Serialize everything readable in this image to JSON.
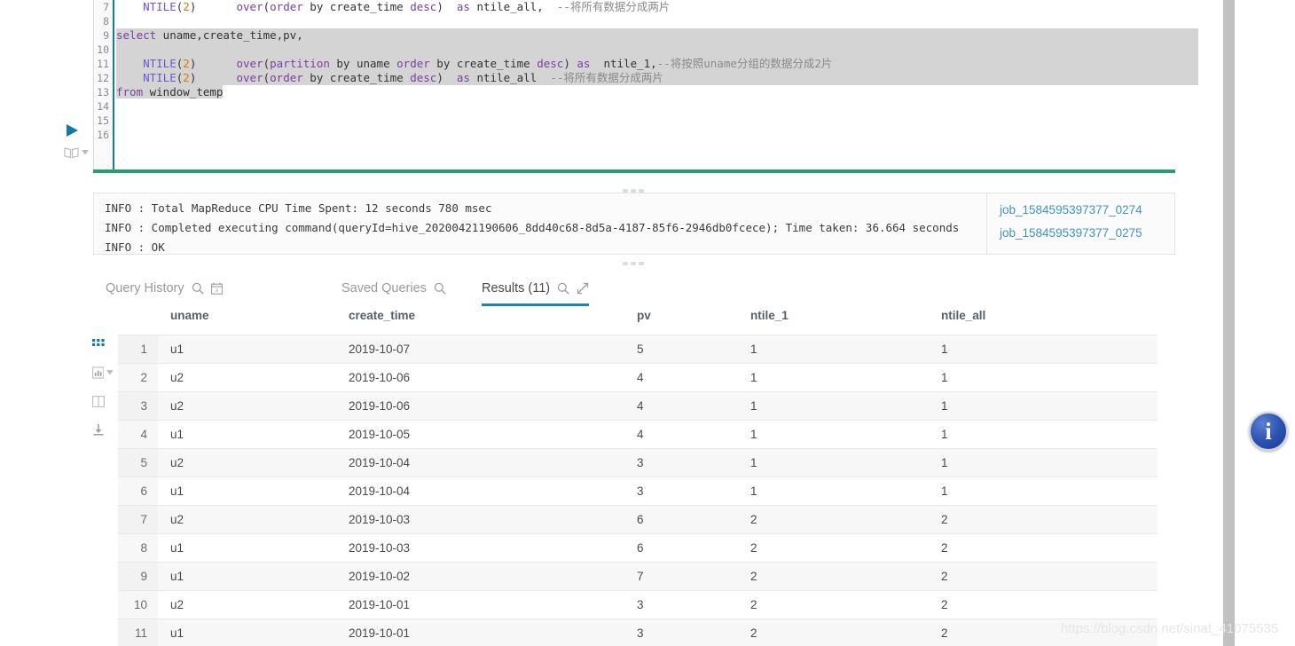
{
  "editor": {
    "run_button": "run-query",
    "book_button": "database-browser",
    "line_numbers": [
      "7",
      "8",
      "9",
      "10",
      "11",
      "12",
      "13",
      "14",
      "15",
      "16"
    ],
    "lines": [
      {
        "n": "7",
        "selected": false,
        "clipped": true,
        "segments": [
          {
            "t": "    ",
            "c": "plain"
          },
          {
            "t": "NTILE",
            "c": "fn"
          },
          {
            "t": "(",
            "c": "plain"
          },
          {
            "t": "2",
            "c": "num"
          },
          {
            "t": ")",
            "c": "plain"
          },
          {
            "t": "      ",
            "c": "plain"
          },
          {
            "t": "over",
            "c": "kw"
          },
          {
            "t": "(",
            "c": "plain"
          },
          {
            "t": "order",
            "c": "kw"
          },
          {
            "t": " by create_time ",
            "c": "plain"
          },
          {
            "t": "desc",
            "c": "kw"
          },
          {
            "t": ")  ",
            "c": "plain"
          },
          {
            "t": "as",
            "c": "kw"
          },
          {
            "t": " ntile_all,  ",
            "c": "plain"
          },
          {
            "t": "--将所有数据分成两片",
            "c": "cmt"
          }
        ]
      },
      {
        "n": "8",
        "selected": false,
        "segments": []
      },
      {
        "n": "9",
        "selected": true,
        "segments": [
          {
            "t": "select",
            "c": "kw"
          },
          {
            "t": " uname,create_time,pv,",
            "c": "plain"
          }
        ]
      },
      {
        "n": "10",
        "selected": true,
        "segments": []
      },
      {
        "n": "11",
        "selected": true,
        "segments": [
          {
            "t": "    ",
            "c": "plain"
          },
          {
            "t": "NTILE",
            "c": "fn"
          },
          {
            "t": "(",
            "c": "plain"
          },
          {
            "t": "2",
            "c": "num"
          },
          {
            "t": ")",
            "c": "plain"
          },
          {
            "t": "      ",
            "c": "plain"
          },
          {
            "t": "over",
            "c": "kw"
          },
          {
            "t": "(",
            "c": "plain"
          },
          {
            "t": "partition",
            "c": "kw"
          },
          {
            "t": " by uname ",
            "c": "plain"
          },
          {
            "t": "order",
            "c": "kw"
          },
          {
            "t": " by create_time ",
            "c": "plain"
          },
          {
            "t": "desc",
            "c": "kw"
          },
          {
            "t": ") ",
            "c": "plain"
          },
          {
            "t": "as",
            "c": "kw"
          },
          {
            "t": "  ntile_1,",
            "c": "plain"
          },
          {
            "t": "--将按照uname分组的数据分成2片",
            "c": "cmt"
          }
        ]
      },
      {
        "n": "12",
        "selected": true,
        "segments": [
          {
            "t": "    ",
            "c": "plain"
          },
          {
            "t": "NTILE",
            "c": "fn"
          },
          {
            "t": "(",
            "c": "plain"
          },
          {
            "t": "2",
            "c": "num"
          },
          {
            "t": ")",
            "c": "plain"
          },
          {
            "t": "      ",
            "c": "plain"
          },
          {
            "t": "over",
            "c": "kw"
          },
          {
            "t": "(",
            "c": "plain"
          },
          {
            "t": "order",
            "c": "kw"
          },
          {
            "t": " by create_time ",
            "c": "plain"
          },
          {
            "t": "desc",
            "c": "kw"
          },
          {
            "t": ")  ",
            "c": "plain"
          },
          {
            "t": "as",
            "c": "kw"
          },
          {
            "t": " ntile_all  ",
            "c": "plain"
          },
          {
            "t": "--将所有数据分成两片",
            "c": "cmt"
          }
        ]
      },
      {
        "n": "13",
        "selected": true,
        "partial": true,
        "segments": [
          {
            "t": "from",
            "c": "kw"
          },
          {
            "t": " window_temp",
            "c": "plain"
          }
        ]
      },
      {
        "n": "14",
        "selected": false,
        "segments": []
      },
      {
        "n": "15",
        "selected": false,
        "segments": []
      },
      {
        "n": "16",
        "selected": false,
        "segments": []
      }
    ]
  },
  "log": {
    "lines": [
      "INFO  : Total MapReduce CPU Time Spent: 12 seconds 780 msec",
      "INFO  : Completed executing command(queryId=hive_20200421190606_8dd40c68-8d5a-4187-85f6-2946db0fcece); Time taken: 36.664 seconds",
      "INFO  : OK"
    ],
    "jobs": [
      "job_1584595397377_0274",
      "job_1584595397377_0275"
    ]
  },
  "tabs": [
    {
      "label": "Query History",
      "active": false,
      "icons": [
        "search-icon",
        "calendar-icon"
      ]
    },
    {
      "label": "Saved Queries",
      "active": false,
      "icons": [
        "search-icon"
      ]
    },
    {
      "label": "Results (11)",
      "active": true,
      "icons": [
        "search-icon",
        "expand-icon"
      ]
    }
  ],
  "result_tools": [
    {
      "name": "grid-view-icon",
      "active": true
    },
    {
      "name": "chart-view-icon",
      "active": false,
      "has_caret": true
    },
    {
      "name": "columns-view-icon",
      "active": false
    },
    {
      "name": "download-icon",
      "active": false
    }
  ],
  "table": {
    "columns": [
      "",
      "uname",
      "create_time",
      "pv",
      "ntile_1",
      "ntile_all"
    ],
    "rows": [
      {
        "idx": "1",
        "uname": "u1",
        "create_time": "2019-10-07",
        "pv": "5",
        "ntile_1": "1",
        "ntile_all": "1"
      },
      {
        "idx": "2",
        "uname": "u2",
        "create_time": "2019-10-06",
        "pv": "4",
        "ntile_1": "1",
        "ntile_all": "1"
      },
      {
        "idx": "3",
        "uname": "u2",
        "create_time": "2019-10-06",
        "pv": "4",
        "ntile_1": "1",
        "ntile_all": "1"
      },
      {
        "idx": "4",
        "uname": "u1",
        "create_time": "2019-10-05",
        "pv": "4",
        "ntile_1": "1",
        "ntile_all": "1"
      },
      {
        "idx": "5",
        "uname": "u2",
        "create_time": "2019-10-04",
        "pv": "3",
        "ntile_1": "1",
        "ntile_all": "1"
      },
      {
        "idx": "6",
        "uname": "u1",
        "create_time": "2019-10-04",
        "pv": "3",
        "ntile_1": "1",
        "ntile_all": "1"
      },
      {
        "idx": "7",
        "uname": "u2",
        "create_time": "2019-10-03",
        "pv": "6",
        "ntile_1": "2",
        "ntile_all": "2"
      },
      {
        "idx": "8",
        "uname": "u1",
        "create_time": "2019-10-03",
        "pv": "6",
        "ntile_1": "2",
        "ntile_all": "2"
      },
      {
        "idx": "9",
        "uname": "u1",
        "create_time": "2019-10-02",
        "pv": "7",
        "ntile_1": "2",
        "ntile_all": "2"
      },
      {
        "idx": "10",
        "uname": "u2",
        "create_time": "2019-10-01",
        "pv": "3",
        "ntile_1": "2",
        "ntile_all": "2"
      },
      {
        "idx": "11",
        "uname": "u1",
        "create_time": "2019-10-01",
        "pv": "3",
        "ntile_1": "2",
        "ntile_all": "2"
      }
    ]
  },
  "info_button": {
    "glyph": "i"
  },
  "watermark": "https://blog.csdn.net/sinat_41075535",
  "colors": {
    "accent_green": "#22a06b",
    "accent_teal": "#2183a8",
    "link_blue": "#3d95c4",
    "gutter_border": "#1579a7",
    "selection": "#d4d4d4"
  }
}
